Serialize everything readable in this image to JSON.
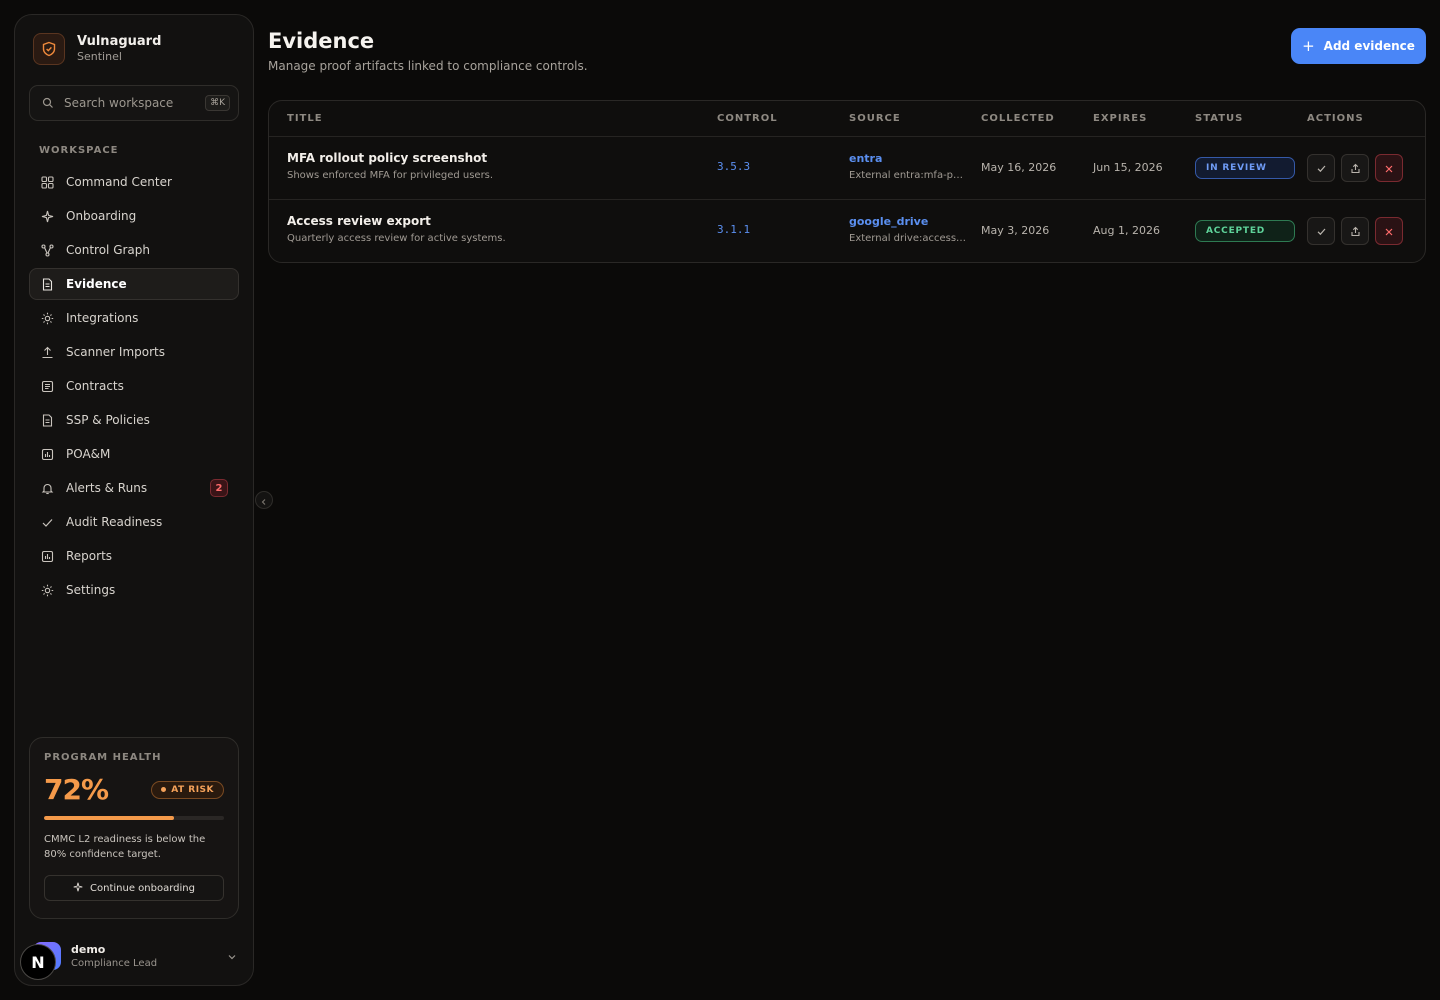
{
  "brand": {
    "name": "Vulnaguard",
    "subtitle": "Sentinel"
  },
  "search": {
    "placeholder": "Search workspace",
    "shortcut": "⌘K"
  },
  "sidebar": {
    "section_label": "WORKSPACE",
    "items": [
      {
        "label": "Command Center",
        "icon": "grid-icon"
      },
      {
        "label": "Onboarding",
        "icon": "sparkle-icon"
      },
      {
        "label": "Control Graph",
        "icon": "graph-icon"
      },
      {
        "label": "Evidence",
        "icon": "document-icon",
        "active": true
      },
      {
        "label": "Integrations",
        "icon": "sun-icon"
      },
      {
        "label": "Scanner Imports",
        "icon": "upload-icon"
      },
      {
        "label": "Contracts",
        "icon": "list-icon"
      },
      {
        "label": "SSP & Policies",
        "icon": "document-icon"
      },
      {
        "label": "POA&M",
        "icon": "bar-chart-icon"
      },
      {
        "label": "Alerts & Runs",
        "icon": "bell-icon",
        "badge": "2"
      },
      {
        "label": "Audit Readiness",
        "icon": "check-icon"
      },
      {
        "label": "Reports",
        "icon": "bar-chart-icon"
      },
      {
        "label": "Settings",
        "icon": "gear-icon"
      }
    ]
  },
  "health": {
    "label": "PROGRAM HEALTH",
    "percent": "72%",
    "progress": 0.72,
    "badge": "AT RISK",
    "note": "CMMC L2 readiness is below the 80% confidence target.",
    "button": "Continue onboarding"
  },
  "user": {
    "name": "demo",
    "role": "Compliance Lead"
  },
  "overlay_badge": "N",
  "page": {
    "title": "Evidence",
    "subtitle": "Manage proof artifacts linked to compliance controls.",
    "add_button": "Add evidence"
  },
  "table": {
    "headers": [
      "TITLE",
      "CONTROL",
      "SOURCE",
      "COLLECTED",
      "EXPIRES",
      "STATUS",
      "ACTIONS"
    ],
    "rows": [
      {
        "title": "MFA rollout policy screenshot",
        "description": "Shows enforced MFA for privileged users.",
        "control": "3.5.3",
        "source": "entra",
        "source_ref": "External entra:mfa-poli...",
        "collected": "May 16, 2026",
        "expires": "Jun 15, 2026",
        "status": "IN REVIEW"
      },
      {
        "title": "Access review export",
        "description": "Quarterly access review for active systems.",
        "control": "3.1.1",
        "source": "google_drive",
        "source_ref": "External drive:access-r...",
        "collected": "May 3, 2026",
        "expires": "Aug 1, 2026",
        "status": "ACCEPTED"
      }
    ]
  },
  "colors": {
    "accent": "#4a86f7",
    "warning": "#f59a4a",
    "danger": "#ff6b6b",
    "success": "#5fd39a"
  }
}
